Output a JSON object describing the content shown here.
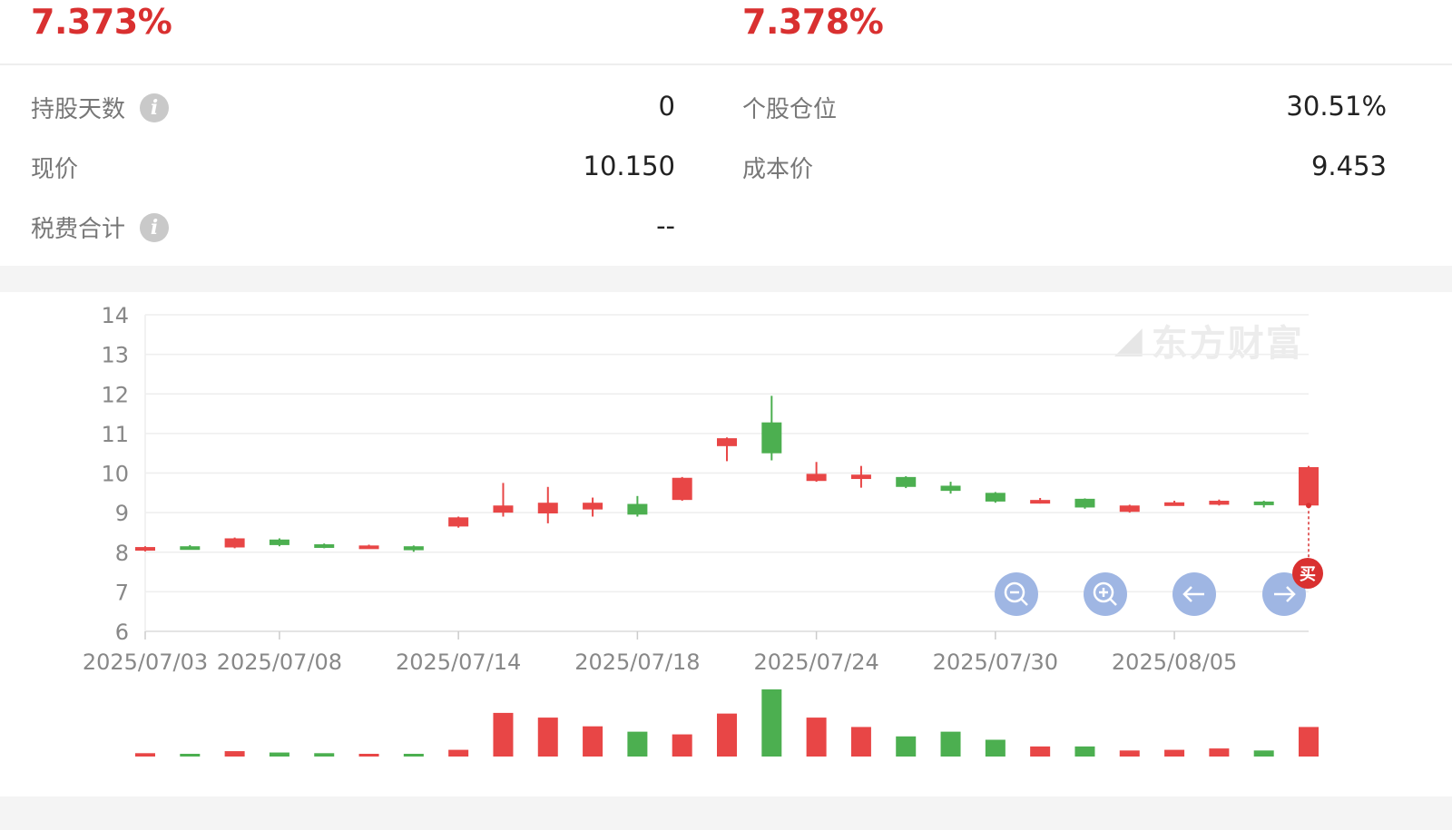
{
  "summary": {
    "left_pct": "7.373%",
    "right_pct": "7.378%"
  },
  "details": {
    "hold_days_label": "持股天数",
    "hold_days_value": "0",
    "position_label": "个股仓位",
    "position_value": "30.51%",
    "price_label": "现价",
    "price_value": "10.150",
    "cost_label": "成本价",
    "cost_value": "9.453",
    "fees_label": "税费合计",
    "fees_value": "--",
    "info_glyph": "i"
  },
  "watermark": "东方财富",
  "buy_badge": "买",
  "colors": {
    "up": "#e84646",
    "down": "#4caf50",
    "accent": "#d93030",
    "control": "#9fb6e3"
  },
  "icons": [
    "info-icon",
    "zoom-out-icon",
    "zoom-in-icon",
    "arrow-left-icon",
    "arrow-right-icon"
  ],
  "chart_data": {
    "type": "candlestick",
    "ylim": [
      6,
      14
    ],
    "y_ticks": [
      "14",
      "13",
      "12",
      "11",
      "10",
      "9",
      "8",
      "7",
      "6"
    ],
    "x_tick_labels": [
      "2025/07/03",
      "2025/07/08",
      "2025/07/14",
      "2025/07/18",
      "2025/07/24",
      "2025/07/30",
      "2025/08/05"
    ],
    "x_tick_candle_index": [
      0,
      3,
      7,
      11,
      15,
      19,
      23
    ],
    "candles": [
      {
        "open": 8.08,
        "close": 8.13,
        "high": 8.15,
        "low": 8.02,
        "dir": "up"
      },
      {
        "open": 8.15,
        "close": 8.1,
        "high": 8.18,
        "low": 8.08,
        "dir": "down"
      },
      {
        "open": 8.12,
        "close": 8.35,
        "high": 8.37,
        "low": 8.1,
        "dir": "up"
      },
      {
        "open": 8.32,
        "close": 8.18,
        "high": 8.35,
        "low": 8.15,
        "dir": "down"
      },
      {
        "open": 8.2,
        "close": 8.12,
        "high": 8.22,
        "low": 8.1,
        "dir": "down"
      },
      {
        "open": 8.13,
        "close": 8.17,
        "high": 8.19,
        "low": 8.1,
        "dir": "up"
      },
      {
        "open": 8.15,
        "close": 8.05,
        "high": 8.17,
        "low": 8.01,
        "dir": "down"
      },
      {
        "open": 8.65,
        "close": 8.88,
        "high": 8.9,
        "low": 8.62,
        "dir": "up"
      },
      {
        "open": 9.0,
        "close": 9.18,
        "high": 9.75,
        "low": 8.9,
        "dir": "up"
      },
      {
        "open": 8.98,
        "close": 9.25,
        "high": 9.65,
        "low": 8.73,
        "dir": "up"
      },
      {
        "open": 9.08,
        "close": 9.25,
        "high": 9.38,
        "low": 8.9,
        "dir": "up"
      },
      {
        "open": 9.22,
        "close": 8.95,
        "high": 9.42,
        "low": 8.9,
        "dir": "down"
      },
      {
        "open": 9.32,
        "close": 9.88,
        "high": 9.9,
        "low": 9.3,
        "dir": "up"
      },
      {
        "open": 10.68,
        "close": 10.88,
        "high": 10.9,
        "low": 10.3,
        "dir": "up"
      },
      {
        "open": 11.28,
        "close": 10.5,
        "high": 11.95,
        "low": 10.32,
        "dir": "down"
      },
      {
        "open": 9.8,
        "close": 9.98,
        "high": 10.28,
        "low": 9.78,
        "dir": "up"
      },
      {
        "open": 9.85,
        "close": 9.96,
        "high": 10.18,
        "low": 9.63,
        "dir": "up"
      },
      {
        "open": 9.9,
        "close": 9.65,
        "high": 9.92,
        "low": 9.62,
        "dir": "down"
      },
      {
        "open": 9.68,
        "close": 9.55,
        "high": 9.78,
        "low": 9.48,
        "dir": "down"
      },
      {
        "open": 9.5,
        "close": 9.28,
        "high": 9.52,
        "low": 9.25,
        "dir": "down"
      },
      {
        "open": 9.25,
        "close": 9.32,
        "high": 9.37,
        "low": 9.23,
        "dir": "up"
      },
      {
        "open": 9.35,
        "close": 9.13,
        "high": 9.36,
        "low": 9.1,
        "dir": "down"
      },
      {
        "open": 9.02,
        "close": 9.18,
        "high": 9.2,
        "low": 9.0,
        "dir": "up"
      },
      {
        "open": 9.2,
        "close": 9.26,
        "high": 9.3,
        "low": 9.18,
        "dir": "up"
      },
      {
        "open": 9.2,
        "close": 9.3,
        "high": 9.33,
        "low": 9.18,
        "dir": "up"
      },
      {
        "open": 9.28,
        "close": 9.22,
        "high": 9.3,
        "low": 9.13,
        "dir": "down"
      },
      {
        "open": 9.18,
        "close": 10.15,
        "high": 10.18,
        "low": 9.15,
        "dir": "up"
      }
    ],
    "volume_relative": [
      0.05,
      0.04,
      0.08,
      0.06,
      0.05,
      0.03,
      0.04,
      0.1,
      0.65,
      0.58,
      0.45,
      0.37,
      0.33,
      0.64,
      1.0,
      0.58,
      0.44,
      0.3,
      0.37,
      0.25,
      0.15,
      0.15,
      0.09,
      0.1,
      0.12,
      0.09,
      0.44
    ],
    "buy_marker_candle_index": 26
  }
}
